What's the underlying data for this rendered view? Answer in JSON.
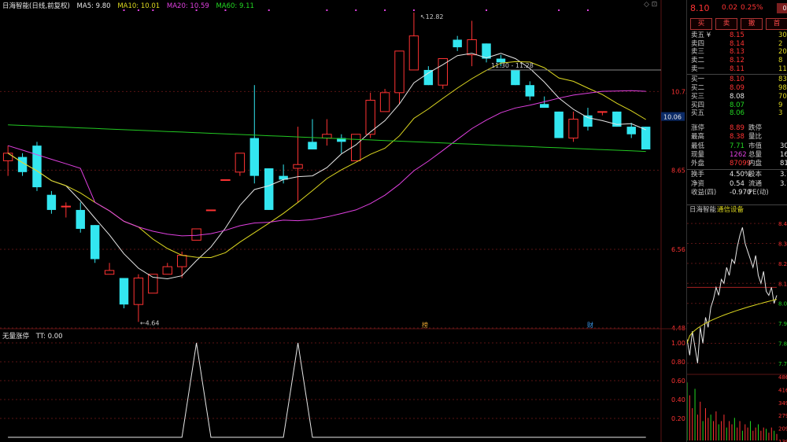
{
  "header": {
    "title": "日海智能(日线,前复权)",
    "ma5": "MA5: 9.80",
    "ma10": "MA10: 10.01",
    "ma20": "MA20: 10.59",
    "ma60": "MA60: 9.11"
  },
  "indicator": {
    "name": "无量涨停",
    "tt": "TT: 0.00",
    "axis": [
      "1.00",
      "0.80",
      "0.60",
      "0.40",
      "0.20"
    ]
  },
  "price_axis": [
    "10.73",
    "8.65",
    "6.56",
    "4.48"
  ],
  "current_tag": "10.06",
  "annotations": {
    "high": "12.82",
    "low": "4.64",
    "range": "11.30 - 11.28",
    "event1": "榜",
    "event2": "财"
  },
  "quote": {
    "price": "8.10",
    "change": "0.02",
    "pct": "0.25%",
    "badge": "0",
    "buy_btn": "买",
    "sell_btn": "卖",
    "cancel_btn": "撤",
    "more_btn": "首"
  },
  "book": {
    "asks": [
      {
        "label": "卖五 ¥",
        "price": "8.15",
        "vol": "30"
      },
      {
        "label": "卖四",
        "price": "8.14",
        "vol": "2"
      },
      {
        "label": "卖三",
        "price": "8.13",
        "vol": "20"
      },
      {
        "label": "卖二",
        "price": "8.12",
        "vol": "8"
      },
      {
        "label": "卖一",
        "price": "8.11",
        "vol": "11"
      }
    ],
    "bids": [
      {
        "label": "买一",
        "price": "8.10",
        "vol": "83"
      },
      {
        "label": "买二",
        "price": "8.09",
        "vol": "98"
      },
      {
        "label": "买三",
        "price": "8.08",
        "vol": "70"
      },
      {
        "label": "买四",
        "price": "8.07",
        "vol": "9"
      },
      {
        "label": "买五",
        "price": "8.06",
        "vol": "3"
      }
    ]
  },
  "stats": [
    {
      "a": "涨停",
      "b": "8.89",
      "c": "跌停",
      "d": ""
    },
    {
      "a": "最高",
      "b": "8.38",
      "c": "量比",
      "d": ""
    },
    {
      "a": "最低",
      "b": "7.71",
      "c": "市值",
      "d": "30"
    },
    {
      "a": "现量",
      "b": "1262",
      "c": "总量",
      "d": "168"
    },
    {
      "a": "外盘",
      "b": "87099",
      "c": "内盘",
      "d": "81"
    },
    {
      "a": "换手",
      "b": "4.50%",
      "c": "股本",
      "d": "3.7"
    },
    {
      "a": "净资",
      "b": "0.54",
      "c": "流通",
      "d": "3.7"
    },
    {
      "a": "收益(四)",
      "b": "-0.970",
      "c": "PE(动)",
      "d": ""
    }
  ],
  "mini": {
    "name": "日海智能",
    "sector": "通信设备",
    "axis": [
      "8.4",
      "8.3",
      "8.2",
      "8.1",
      "8.0",
      "7.9",
      "7.8",
      "7.7"
    ],
    "vol_axis": [
      "486",
      "416",
      "349",
      "279",
      "209",
      "139"
    ]
  },
  "colors": {
    "up": "#ff3333",
    "down": "#33e6f0",
    "ma5": "#e6e6e6",
    "ma10": "#ddd820",
    "ma20": "#e040e0",
    "ma60": "#22c822"
  }
}
